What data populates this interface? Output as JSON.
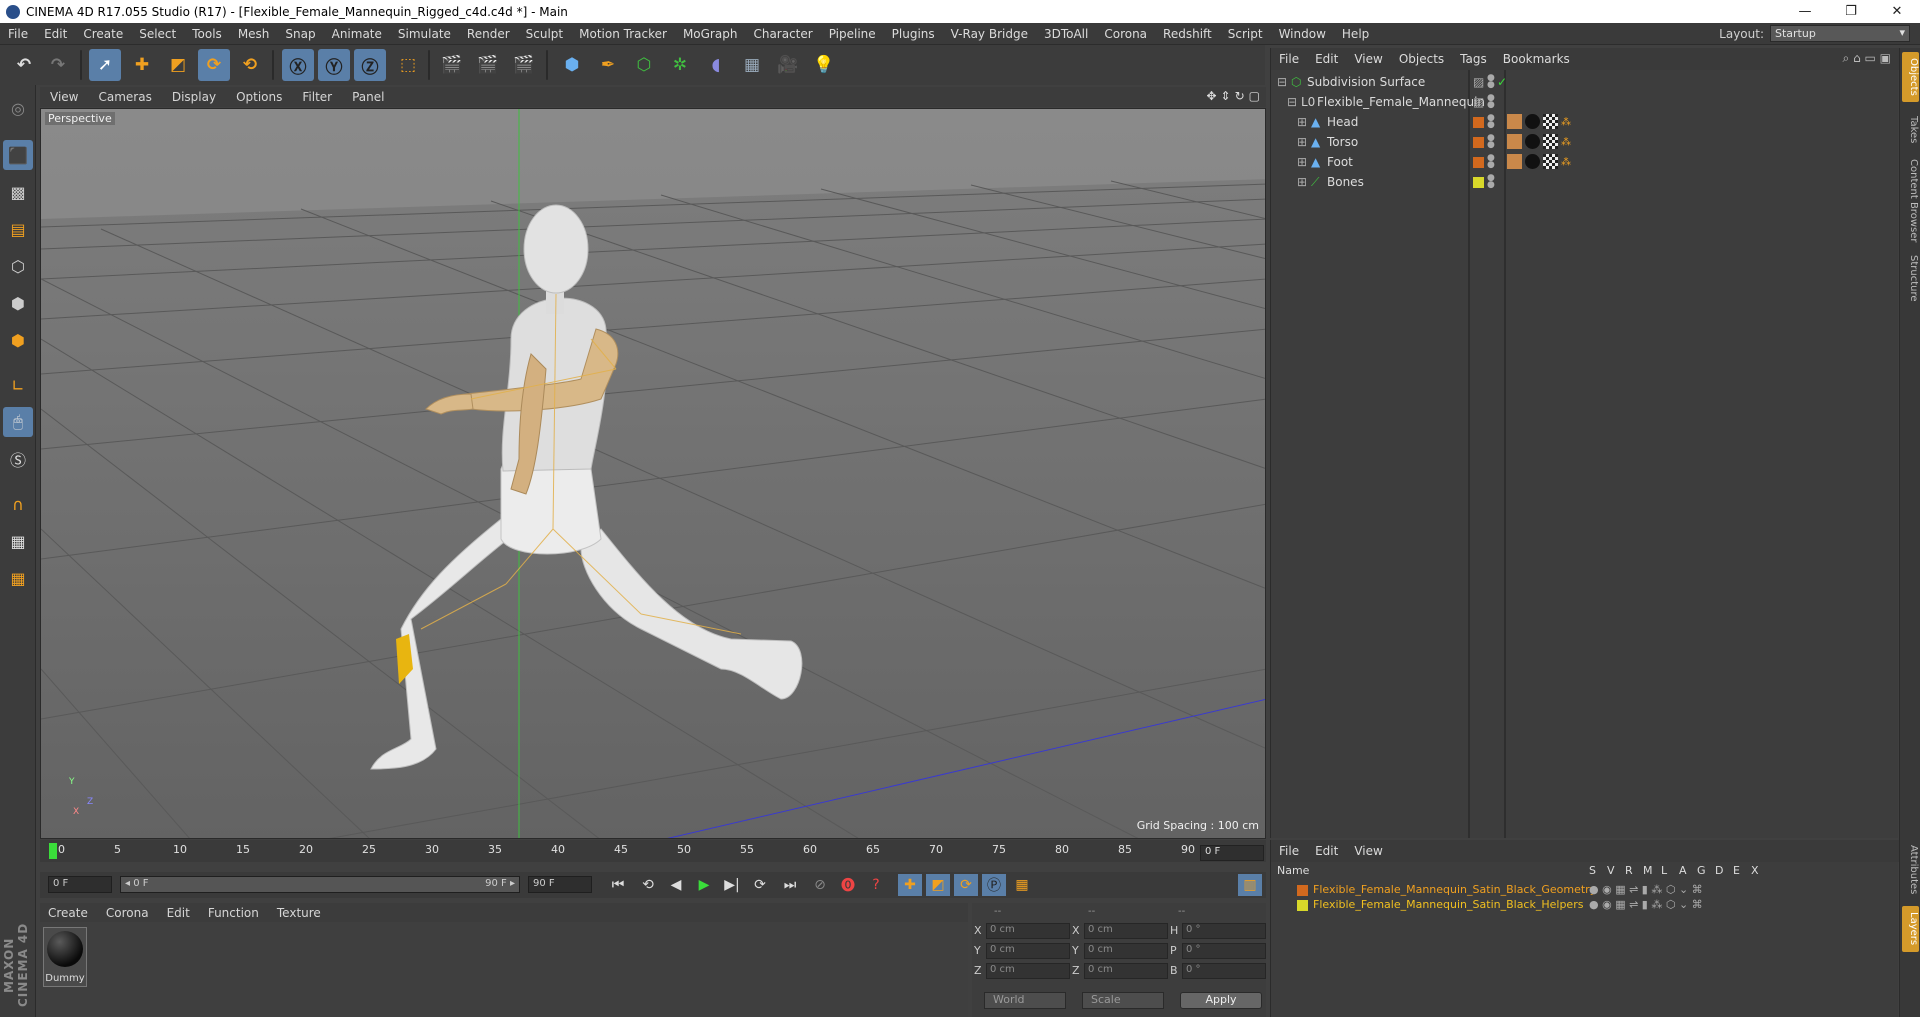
{
  "window": {
    "title": "CINEMA 4D R17.055 Studio (R17) - [Flexible_Female_Mannequin_Rigged_c4d.c4d *] - Main",
    "minimize": "—",
    "restore": "❐",
    "close": "✕"
  },
  "menubar": {
    "items": [
      "File",
      "Edit",
      "Create",
      "Select",
      "Tools",
      "Mesh",
      "Snap",
      "Animate",
      "Simulate",
      "Render",
      "Sculpt",
      "Motion Tracker",
      "MoGraph",
      "Character",
      "Pipeline",
      "Plugins",
      "V-Ray Bridge",
      "3DToAll",
      "Corona",
      "Redshift",
      "Script",
      "Window",
      "Help"
    ],
    "layout_label": "Layout:",
    "layout_value": "Startup"
  },
  "viewport": {
    "menu": [
      "View",
      "Cameras",
      "Display",
      "Options",
      "Filter",
      "Panel"
    ],
    "label": "Perspective",
    "grid_spacing": "Grid Spacing : 100 cm"
  },
  "timeline": {
    "ticks": [
      "0",
      "5",
      "10",
      "15",
      "20",
      "25",
      "30",
      "35",
      "40",
      "45",
      "50",
      "55",
      "60",
      "65",
      "70",
      "75",
      "80",
      "85",
      "90"
    ],
    "current_frame": "0 F",
    "start_field": "0 F",
    "range_start": "◂ 0 F",
    "range_end": "90 F ▸",
    "end_field": "90 F"
  },
  "material": {
    "menu": [
      "Create",
      "Corona",
      "Edit",
      "Function",
      "Texture"
    ],
    "items": [
      {
        "name": "Dummy"
      }
    ]
  },
  "coordinates": {
    "headers": [
      "--",
      "--",
      "--"
    ],
    "rows": [
      {
        "a": "X",
        "v1": "0 cm",
        "b": "X",
        "v2": "0 cm",
        "c": "H",
        "v3": "0 °"
      },
      {
        "a": "Y",
        "v1": "0 cm",
        "b": "Y",
        "v2": "0 cm",
        "c": "P",
        "v3": "0 °"
      },
      {
        "a": "Z",
        "v1": "0 cm",
        "b": "Z",
        "v2": "0 cm",
        "c": "B",
        "v3": "0 °"
      }
    ],
    "mode1": "World",
    "mode2": "Scale",
    "apply": "Apply"
  },
  "objects": {
    "menu": [
      "File",
      "Edit",
      "View",
      "Objects",
      "Tags",
      "Bookmarks"
    ],
    "rows": [
      {
        "name": "Subdivision Surface",
        "color": "",
        "level": 0
      },
      {
        "name": "Flexible_Female_Mannequin",
        "color": "",
        "level": 1
      },
      {
        "name": "Head",
        "color": "#d2691e",
        "level": 2
      },
      {
        "name": "Torso",
        "color": "#d2691e",
        "level": 2
      },
      {
        "name": "Foot",
        "color": "#d2691e",
        "level": 2
      },
      {
        "name": "Bones",
        "color": "#d8d82a",
        "level": 2
      }
    ]
  },
  "layers": {
    "menu": [
      "File",
      "Edit",
      "View"
    ],
    "columns": [
      "Name",
      "S",
      "V",
      "R",
      "M",
      "L",
      "A",
      "G",
      "D",
      "E",
      "X"
    ],
    "rows": [
      {
        "name": "Flexible_Female_Mannequin_Satin_Black_Geometry",
        "color": "#d2691e"
      },
      {
        "name": "Flexible_Female_Mannequin_Satin_Black_Helpers",
        "color": "#d8d82a"
      }
    ]
  },
  "right_tabs": [
    "Objects",
    "Takes",
    "Content Browser",
    "Structure"
  ],
  "right_tabs_bottom": [
    "Attributes",
    "Layers"
  ],
  "brand": "MAXON CINEMA 4D",
  "axes": {
    "x": "X",
    "y": "Y",
    "z": "Z"
  }
}
